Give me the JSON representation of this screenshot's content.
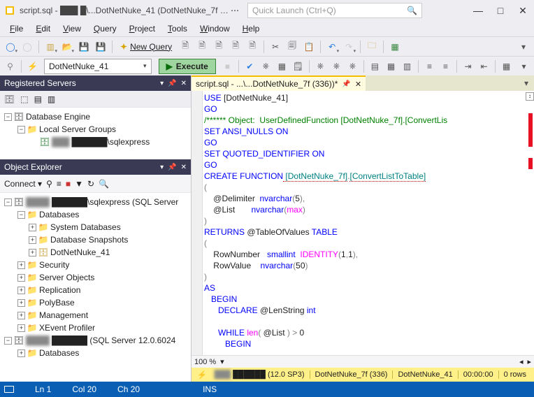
{
  "title": "script.sql - ███ █\\...DotNetNuke_41 (DotNetNuke_7f (336))* - Mi...",
  "quick_launch_placeholder": "Quick Launch (Ctrl+Q)",
  "menu": {
    "file": "File",
    "edit": "Edit",
    "view": "View",
    "query": "Query",
    "project": "Project",
    "tools": "Tools",
    "window": "Window",
    "help": "Help"
  },
  "toolbar1": {
    "new_query": "New Query"
  },
  "toolbar2": {
    "db_selected": "DotNetNuke_41",
    "execute": "Execute"
  },
  "registered": {
    "title": "Registered Servers",
    "root": "Database Engine",
    "group": "Local Server Groups",
    "server": "██████\\sqlexpress"
  },
  "object_explorer": {
    "title": "Object Explorer",
    "connect": "Connect",
    "root": "██████\\sqlexpress (SQL Server",
    "nodes": {
      "databases": "Databases",
      "sysdb": "System Databases",
      "snapshots": "Database Snapshots",
      "dnn41": "DotNetNuke_41",
      "security": "Security",
      "serverobj": "Server Objects",
      "replication": "Replication",
      "polybase": "PolyBase",
      "management": "Management",
      "xevent": "XEvent Profiler"
    },
    "root2": "██████ (SQL Server 12.0.6024",
    "databases2": "Databases"
  },
  "editor_tab": "script.sql - ...\\...DotNetNuke_7f (336))*",
  "code": {
    "l1a": "USE",
    "l1b": " [DotNetNuke_41]",
    "l2": "GO",
    "l3": "/****** Object:  UserDefinedFunction [DotNetNuke_7f].[ConvertLis",
    "l4a": "SET",
    "l4b": " ANSI_NULLS ",
    "l4c": "ON",
    "l5": "GO",
    "l6a": "SET",
    "l6b": " QUOTED_IDENTIFIER ",
    "l6c": "ON",
    "l7": "GO",
    "l8a": "CREATE",
    "l8b": " FUNCTION",
    "l8c": " [DotNetNuke_7f]",
    "l8d": ".",
    "l8e": "[ConvertListToTable]",
    "l9": "(",
    "l10a": "    @Delimiter  ",
    "l10b": "nvarchar",
    "l10c": "(",
    "l10d": "5",
    "l10e": "),",
    "l11a": "    @List       ",
    "l11b": "nvarchar",
    "l11c": "(",
    "l11d": "max",
    "l11e": ")",
    "l12": ")",
    "l13a": "RETURNS",
    "l13b": " @TableOfValues ",
    "l13c": "TABLE",
    "l14": "(",
    "l15a": "    RowNumber   ",
    "l15b": "smallint",
    "l15c": " IDENTITY",
    "l15d": "(",
    "l15e": "1",
    "l15f": ",",
    "l15g": "1",
    "l15h": "),",
    "l16a": "    RowValue    ",
    "l16b": "nvarchar",
    "l16c": "(",
    "l16d": "50",
    "l16e": ")",
    "l17": ")",
    "l18": "AS",
    "l19": "   BEGIN",
    "l20a": "      DECLARE",
    "l20b": " @LenString ",
    "l20c": "int",
    "l21a": "      WHILE",
    "l21b": " len",
    "l21c": "(",
    "l21d": " @List ",
    "l21e": ")",
    "l21f": " >",
    "l21g": " 0",
    "l22": "         BEGIN"
  },
  "zoom": "100 %",
  "connbar": {
    "server": "██████ (12.0 SP3)",
    "user": "DotNetNuke_7f (336)",
    "db": "DotNetNuke_41",
    "time": "00:00:00",
    "rows": "0 rows"
  },
  "status": {
    "ln": "Ln 1",
    "col": "Col 20",
    "ch": "Ch 20",
    "ins": "INS"
  }
}
